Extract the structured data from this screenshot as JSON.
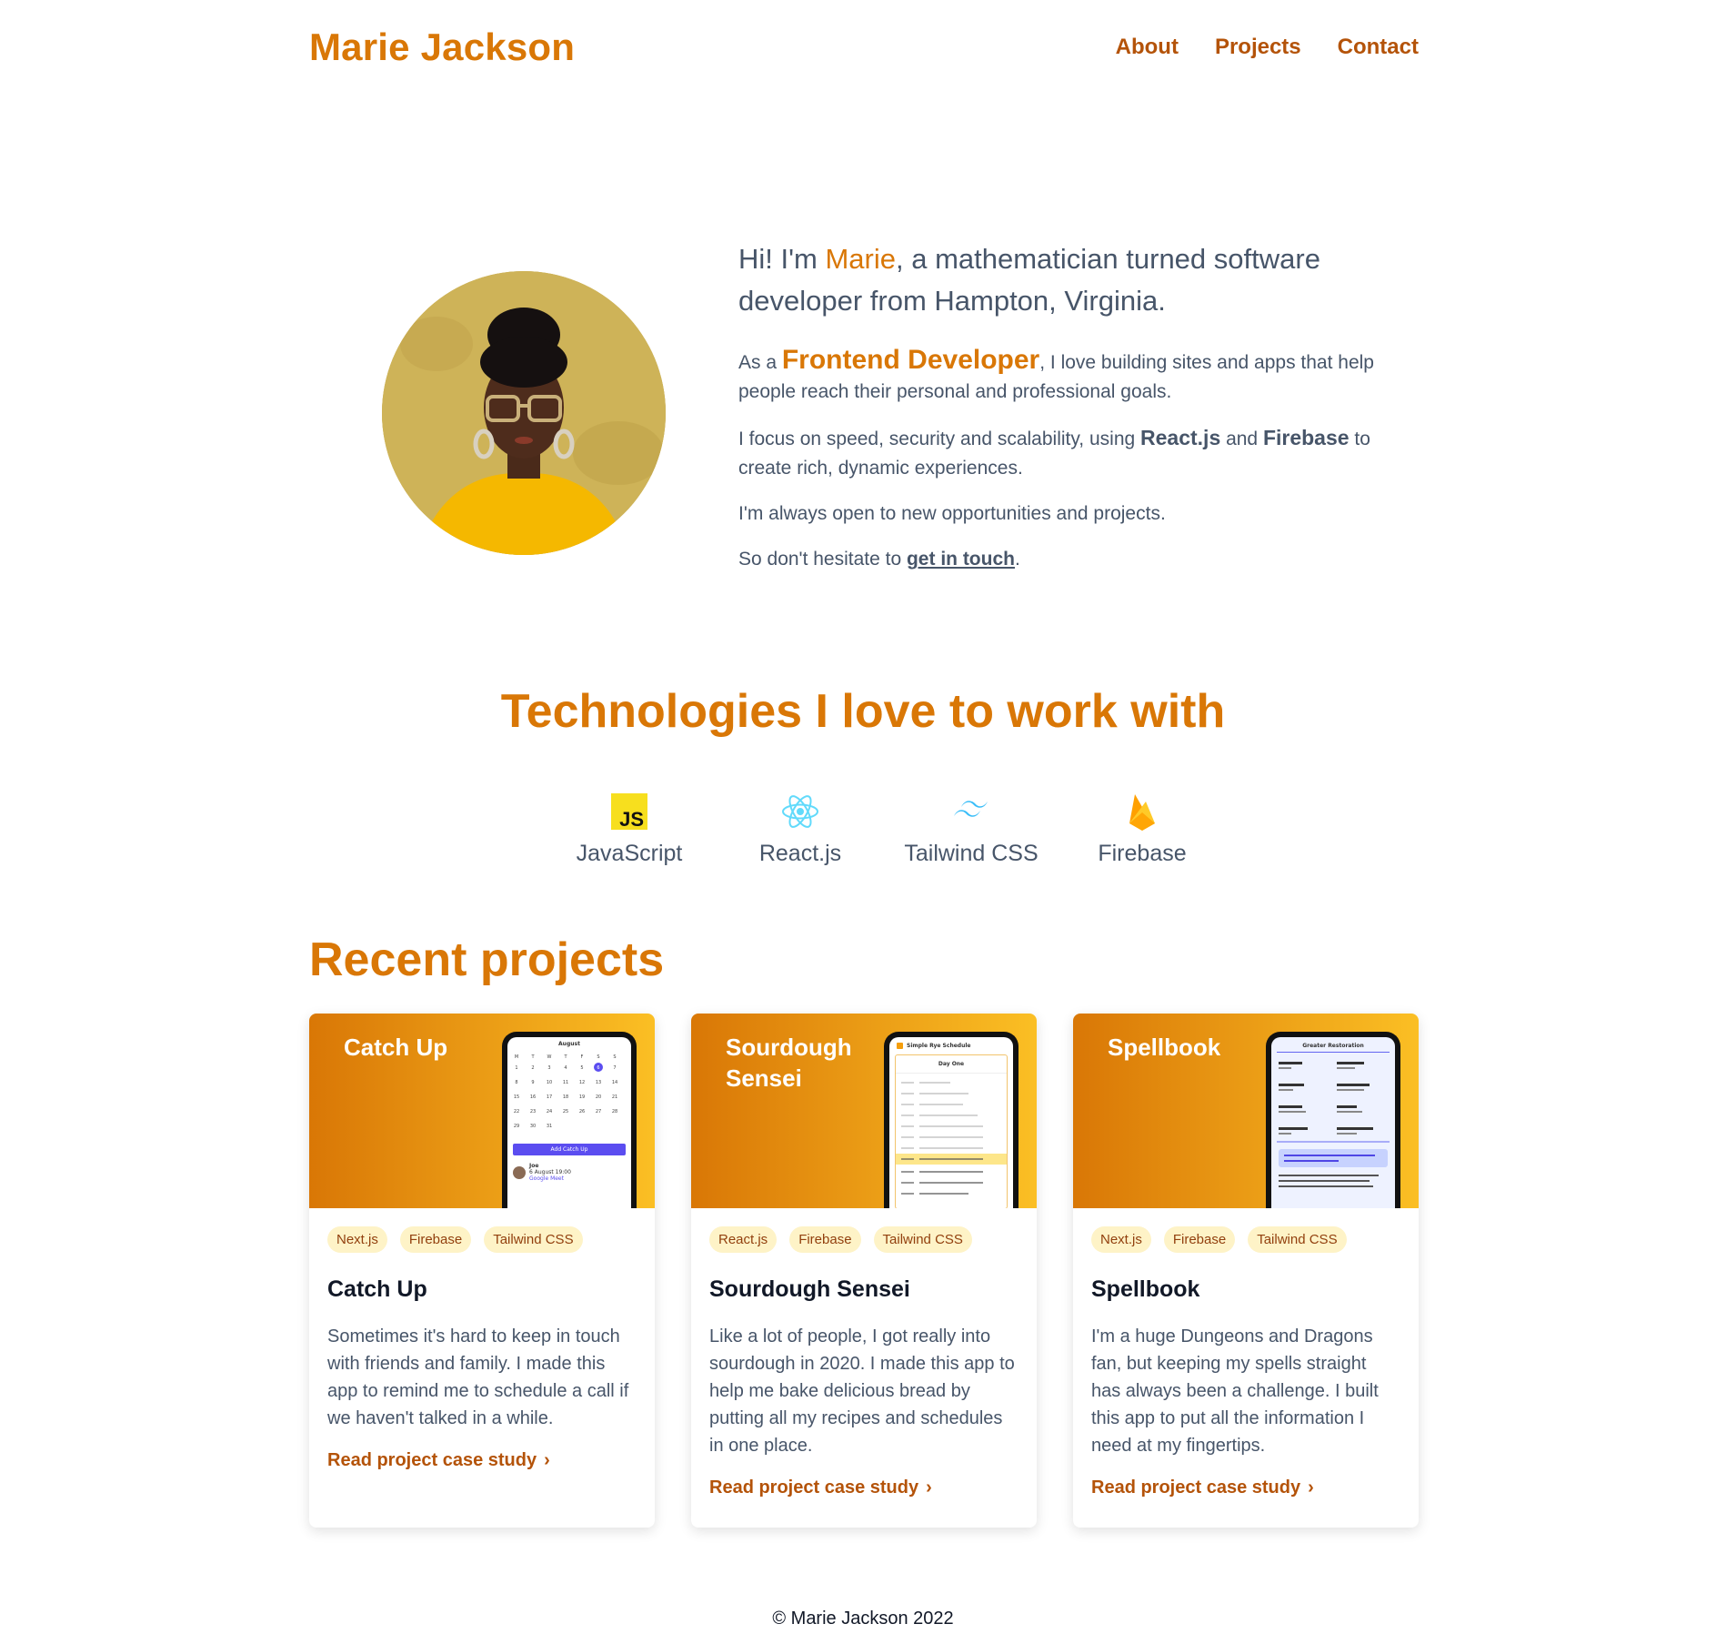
{
  "header": {
    "brand": "Marie Jackson",
    "nav": [
      "About",
      "Projects",
      "Contact"
    ]
  },
  "hero": {
    "lead_pre": "Hi! I'm ",
    "lead_name": "Marie",
    "lead_post": ", a mathematician turned software developer from Hampton, Virginia.",
    "p1_pre": "As a ",
    "p1_role": "Frontend Developer",
    "p1_post": ", I love building sites and apps that help people reach their personal and professional goals.",
    "p2_pre": "I focus on speed, security and scalability, using ",
    "p2_tech1": "React.js",
    "p2_mid": " and ",
    "p2_tech2": "Firebase",
    "p2_post": " to create rich, dynamic experiences.",
    "p3": "I'm always open to new opportunities and projects.",
    "p4_pre": "So don't hesitate to ",
    "p4_link": "get in touch",
    "p4_post": "."
  },
  "technologies": {
    "title": "Technologies I love to work with",
    "items": [
      {
        "label": "JavaScript",
        "icon": "javascript-icon",
        "color": "#f7df1e"
      },
      {
        "label": "React.js",
        "icon": "react-icon",
        "color": "#61dafb"
      },
      {
        "label": "Tailwind CSS",
        "icon": "tailwind-icon",
        "color": "#38bdf8"
      },
      {
        "label": "Firebase",
        "icon": "firebase-icon",
        "color": "#ffca28"
      }
    ]
  },
  "projects": {
    "title": "Recent projects",
    "link_label": "Read project case study",
    "items": [
      {
        "banner_title": "Catch Up",
        "tags": [
          "Next.js",
          "Firebase",
          "Tailwind CSS"
        ],
        "title": "Catch Up",
        "description": "Sometimes it's hard to keep in touch with friends and family. I made this app to remind me to schedule a call if we haven't talked in a while.",
        "screen": {
          "month": "August",
          "button": "Add Catch Up",
          "contact": "Joe",
          "date": "6 August 19:00",
          "meet": "Google Meet"
        }
      },
      {
        "banner_title": "Sourdough Sensei",
        "tags": [
          "React.js",
          "Firebase",
          "Tailwind CSS"
        ],
        "title": "Sourdough Sensei",
        "description": "Like a lot of people, I got really into sourdough in 2020. I made this app to help me bake delicious bread by putting all my recipes and schedules in one place.",
        "screen": {
          "heading": "Simple Rye Schedule",
          "day": "Day One"
        }
      },
      {
        "banner_title": "Spellbook",
        "tags": [
          "Next.js",
          "Firebase",
          "Tailwind CSS"
        ],
        "title": "Spellbook",
        "description": "I'm a huge Dungeons and Dragons fan, but keeping my spells straight has always been a challenge. I built this app to put all the information I need at my fingertips.",
        "screen": {
          "heading": "Greater Restoration"
        }
      }
    ]
  },
  "footer": {
    "text": "© Marie Jackson 2022"
  },
  "colors": {
    "accent": "#d97706",
    "link": "#b45309",
    "text": "#475569",
    "tag_bg": "#fef3c7"
  }
}
